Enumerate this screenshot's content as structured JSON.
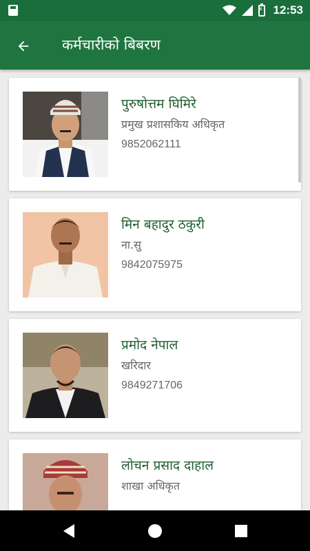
{
  "status_bar": {
    "time": "12:53"
  },
  "app_bar": {
    "title": "कर्मचारीको बिबरण"
  },
  "employees": [
    {
      "name": "पुरुषोत्तम घिमिरे",
      "post": "प्रमुख प्रशासकिय अधिकृत",
      "phone": "9852062111"
    },
    {
      "name": "मिन बहादुर ठकुरी",
      "post": "ना.सु",
      "phone": "9842075975"
    },
    {
      "name": "प्रमोद नेपाल",
      "post": "खरिदार",
      "phone": "9849271706"
    },
    {
      "name": "लोचन प्रसाद दाहाल",
      "post": "शाखा अधिकृत",
      "phone": ""
    }
  ],
  "colors": {
    "primary": "#1f7540",
    "status": "#1a6e3c",
    "name_text": "#215e2e"
  }
}
